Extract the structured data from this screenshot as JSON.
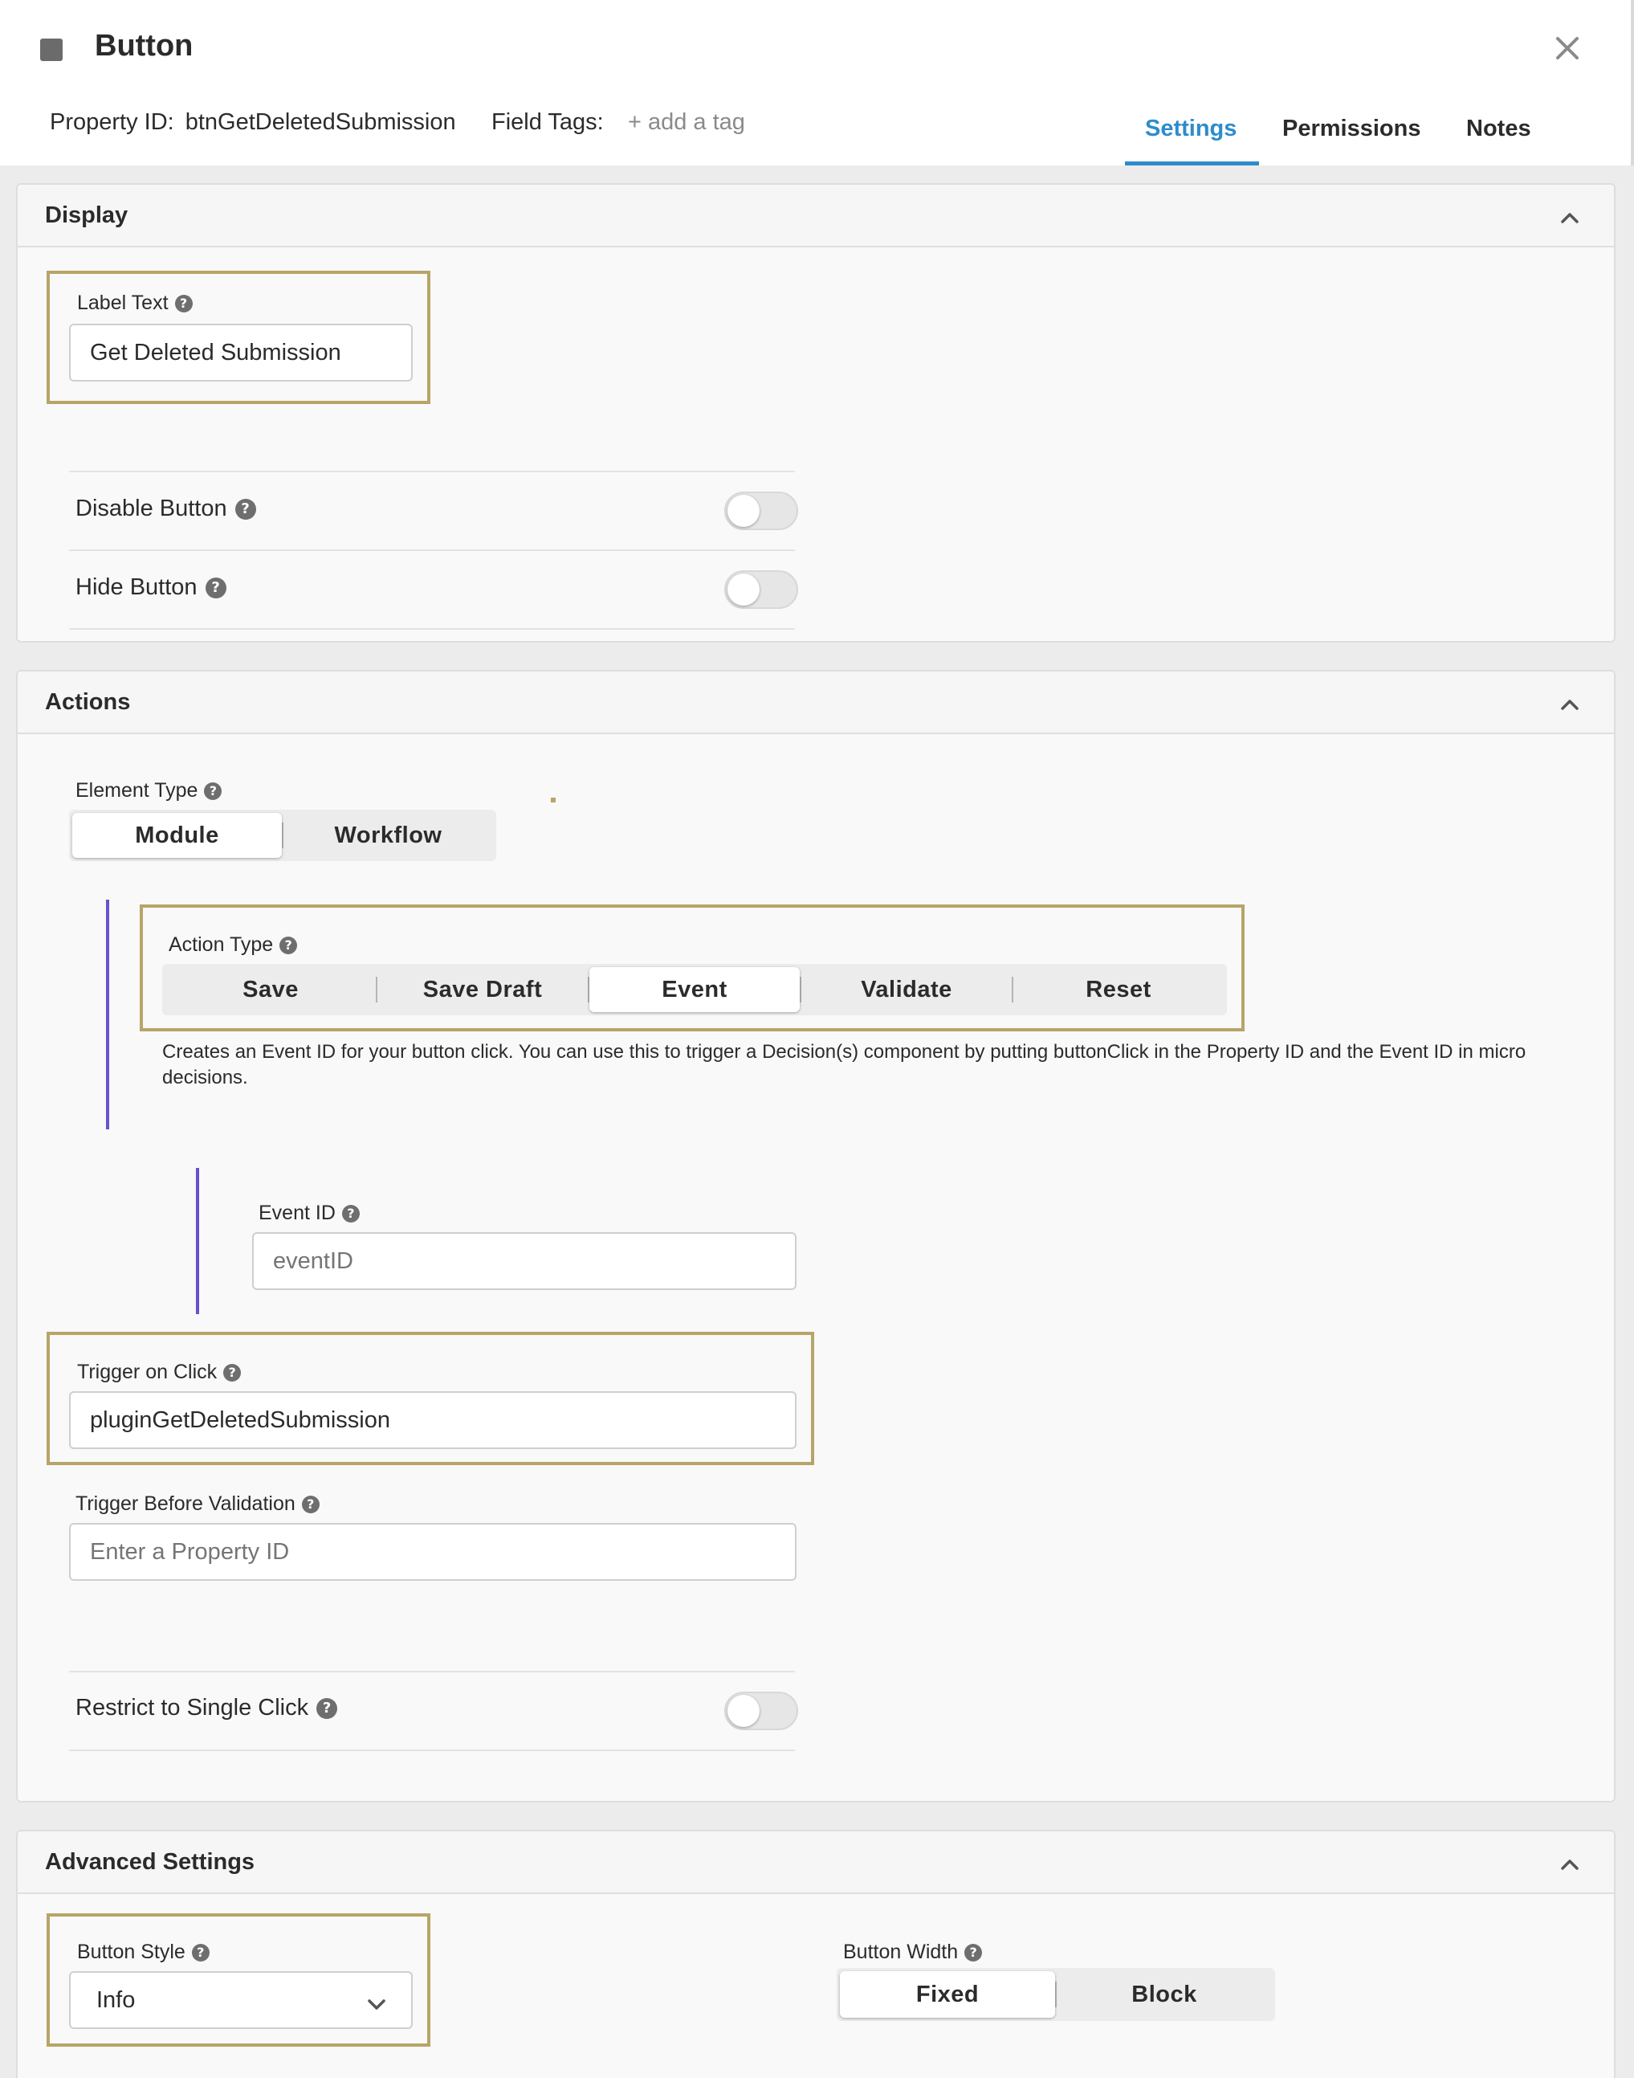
{
  "header": {
    "title": "Button",
    "property_id_label": "Property ID:",
    "property_id_value": "btnGetDeletedSubmission",
    "field_tags_label": "Field Tags:",
    "add_tag": "+ add a tag",
    "tabs": [
      {
        "label": "Settings",
        "active": true
      },
      {
        "label": "Permissions",
        "active": false
      },
      {
        "label": "Notes",
        "active": false
      }
    ]
  },
  "display": {
    "title": "Display",
    "label_text": {
      "label": "Label Text",
      "value": "Get Deleted Submission"
    },
    "disable_button": {
      "label": "Disable Button",
      "on": false
    },
    "hide_button": {
      "label": "Hide Button",
      "on": false
    }
  },
  "actions": {
    "title": "Actions",
    "element_type": {
      "label": "Element Type",
      "options": [
        "Module",
        "Workflow"
      ],
      "selected": "Module"
    },
    "action_type": {
      "label": "Action Type",
      "options": [
        "Save",
        "Save Draft",
        "Event",
        "Validate",
        "Reset"
      ],
      "selected": "Event"
    },
    "description": "Creates an Event ID for your button click. You can use this to trigger a Decision(s) component by putting buttonClick in the Property ID and the Event ID in micro decisions.",
    "event_id": {
      "label": "Event ID",
      "placeholder": "eventID"
    },
    "trigger_on_click": {
      "label": "Trigger on Click",
      "value": "pluginGetDeletedSubmission"
    },
    "trigger_before_validation": {
      "label": "Trigger Before Validation",
      "placeholder": "Enter a Property ID"
    },
    "restrict_single_click": {
      "label": "Restrict to Single Click",
      "on": false
    }
  },
  "advanced": {
    "title": "Advanced Settings",
    "button_style": {
      "label": "Button Style",
      "value": "Info"
    },
    "button_width": {
      "label": "Button Width",
      "options": [
        "Fixed",
        "Block"
      ],
      "selected": "Fixed"
    }
  },
  "colors": {
    "accent": "#2d8ccc",
    "highlight": "#b8a468",
    "branch": "#6a4fd0"
  }
}
